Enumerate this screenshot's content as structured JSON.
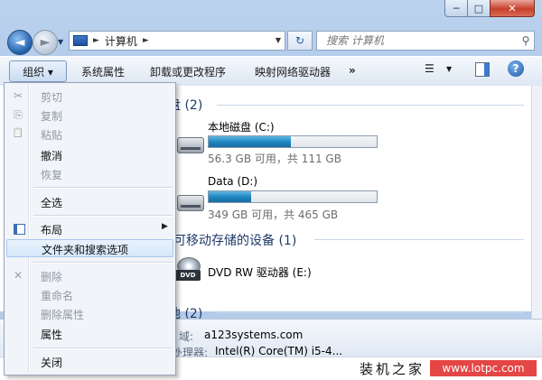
{
  "window": {
    "caption_minimize": "─",
    "caption_maximize": "□",
    "caption_close": "✕"
  },
  "nav": {
    "back_glyph": "◄",
    "forward_glyph": "►",
    "history_glyph": "▼"
  },
  "address": {
    "crumb": "计算机",
    "separator": "►",
    "dropdown_glyph": "▼",
    "refresh_glyph": "↻"
  },
  "search": {
    "placeholder": "搜索 计算机",
    "icon": "search-icon"
  },
  "command_bar": {
    "organize": "组织 ▾",
    "system_properties": "系统属性",
    "uninstall": "卸载或更改程序",
    "map_drive": "映射网络驱动器",
    "more": "»",
    "views_glyph": "☰",
    "views_drop": "▼",
    "help_glyph": "?"
  },
  "groups": {
    "hard_disks": "盘 (2)",
    "removable": "可移动存储的设备 (1)",
    "other": "他 (2)"
  },
  "drives": [
    {
      "name": "本地磁盘 (C:)",
      "info": "56.3 GB 可用，共 111 GB",
      "used_fraction": 0.49
    },
    {
      "name": "Data (D:)",
      "info": "349 GB 可用，共 465 GB",
      "used_fraction": 0.25
    }
  ],
  "dvd": {
    "name": "DVD RW 驱动器 (E:)",
    "icon_label": "DVD"
  },
  "details": {
    "domain_key": "域:",
    "domain_val": "a123systems.com",
    "cpu_key": "处理器:",
    "cpu_val": "Intel(R) Core(TM) i5-4..."
  },
  "menu": {
    "cut": "剪切",
    "copy": "复制",
    "paste": "粘贴",
    "undo": "撤消",
    "redo": "恢复",
    "select_all": "全选",
    "layout": "布局",
    "folder_options": "文件夹和搜索选项",
    "delete": "删除",
    "rename": "重命名",
    "remove_properties": "删除属性",
    "properties": "属性",
    "close": "关闭",
    "submenu_arrow": "▶",
    "cut_icon": "✂",
    "copy_icon": "⎘",
    "paste_icon": "📋",
    "delete_icon": "✕"
  },
  "watermark": {
    "brand": "装机之家",
    "url": "www.lotpc.com"
  }
}
